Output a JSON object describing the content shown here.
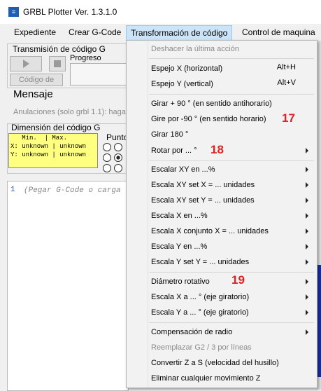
{
  "window": {
    "title": "GRBL Plotter Ver. 1.3.1.0",
    "icon": "app-logo-icon"
  },
  "menubar": {
    "items": [
      {
        "label": "Expediente"
      },
      {
        "label": "Crear G-Code"
      },
      {
        "label": "Transformación de código",
        "active": true
      },
      {
        "label": "Control de maquina"
      }
    ]
  },
  "left": {
    "transmission_group": "Transmisión de código G",
    "progress_label": "Progreso",
    "code_button": "Código de",
    "message_label": "Mensaje",
    "overrides_label": "Anulaciones (solo grbl 1.1): haga c",
    "dimension_group": "Dimensión del código G",
    "dim_header": "   Min.  | Max.",
    "dim_x": "X: unknown | unknown",
    "dim_y": "Y: unknown | unknown",
    "point_label": "Punto",
    "editor_line": "1",
    "editor_placeholder": "(Pegar G-Code o carga"
  },
  "dropdown": {
    "items": [
      {
        "label": "Deshacer la última acción",
        "disabled": true,
        "shortcut": "",
        "submenu": false
      },
      {
        "label": "Espejo X (horizontal)",
        "shortcut": "Alt+H",
        "submenu": false
      },
      {
        "label": "Espejo Y (vertical)",
        "shortcut": "Alt+V",
        "submenu": false
      },
      {
        "label": "Girar + 90 ° (en sentido antihorario)",
        "shortcut": "",
        "submenu": false
      },
      {
        "label": "Gire por -90 ° (en sentido horario)",
        "shortcut": "",
        "submenu": false,
        "annotation": "17"
      },
      {
        "label": "Girar 180 °",
        "shortcut": "",
        "submenu": false
      },
      {
        "label": "Rotar por ... °",
        "shortcut": "",
        "submenu": true,
        "annotation": "18"
      },
      {
        "label": "Escalar XY en ...%",
        "submenu": true
      },
      {
        "label": "Escala XY set X = ... unidades",
        "submenu": true
      },
      {
        "label": "Escala XY set Y = ... unidades",
        "submenu": true
      },
      {
        "label": "Escala X en ...%",
        "submenu": true
      },
      {
        "label": "Escala X conjunto X = ... unidades",
        "submenu": true
      },
      {
        "label": "Escala Y en ...%",
        "submenu": true
      },
      {
        "label": "Escala Y set Y = ... unidades",
        "submenu": true
      },
      {
        "label": "Diámetro rotativo",
        "submenu": true,
        "annotation": "19"
      },
      {
        "label": "Escala X a ... ° (eje giratorio)",
        "submenu": true
      },
      {
        "label": "Escala Y a ... ° (eje giratorio)",
        "submenu": true
      },
      {
        "label": "Compensación de radio",
        "submenu": true
      },
      {
        "label": "Reemplazar G2 / 3 por líneas",
        "disabled": true,
        "submenu": false
      },
      {
        "label": "Convertir Z a S (velocidad del husillo)",
        "submenu": false
      },
      {
        "label": "Eliminar cualquier movimiento Z",
        "submenu": false
      }
    ]
  },
  "colors": {
    "menu_highlight": "#cce4f7",
    "annotation": "#dd2222",
    "dim_box": "#ffff80"
  }
}
